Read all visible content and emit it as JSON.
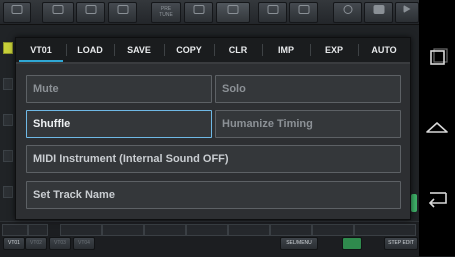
{
  "topbar": {
    "buttons": [
      {
        "label": ""
      },
      {
        "label": ""
      },
      {
        "label": ""
      },
      {
        "label": ""
      },
      {
        "label": "PRE\nTUNE"
      },
      {
        "label": ""
      },
      {
        "label": ""
      },
      {
        "label": ""
      },
      {
        "label": ""
      },
      {
        "label": ""
      },
      {
        "label": ""
      },
      {
        "label": ""
      }
    ]
  },
  "dialog": {
    "tabs": [
      {
        "label": "VT01",
        "active": true
      },
      {
        "label": "LOAD",
        "active": false
      },
      {
        "label": "SAVE",
        "active": false
      },
      {
        "label": "COPY",
        "active": false
      },
      {
        "label": "CLR",
        "active": false
      },
      {
        "label": "IMP",
        "active": false
      },
      {
        "label": "EXP",
        "active": false
      },
      {
        "label": "AUTO",
        "active": false
      }
    ],
    "options": {
      "mute": "Mute",
      "solo": "Solo",
      "shuffle": "Shuffle",
      "humanize_timing": "Humanize Timing",
      "midi_instrument": "MIDI Instrument (Internal Sound OFF)",
      "set_track_name": "Set Track Name"
    },
    "selected_option": "Shuffle"
  },
  "bottombar": {
    "track_labels": [
      "VT01",
      "VT02",
      "VT03",
      "VT04"
    ],
    "sel_menu": "SEL/MENU",
    "step_edit": "STEP EDIT"
  },
  "colors": {
    "accent": "#2fa7d4",
    "selected_border": "#6fb9e6",
    "marker": "#3fb46a"
  },
  "navbar": {
    "icons": [
      "recent-apps-icon",
      "home-icon",
      "back-icon"
    ]
  }
}
